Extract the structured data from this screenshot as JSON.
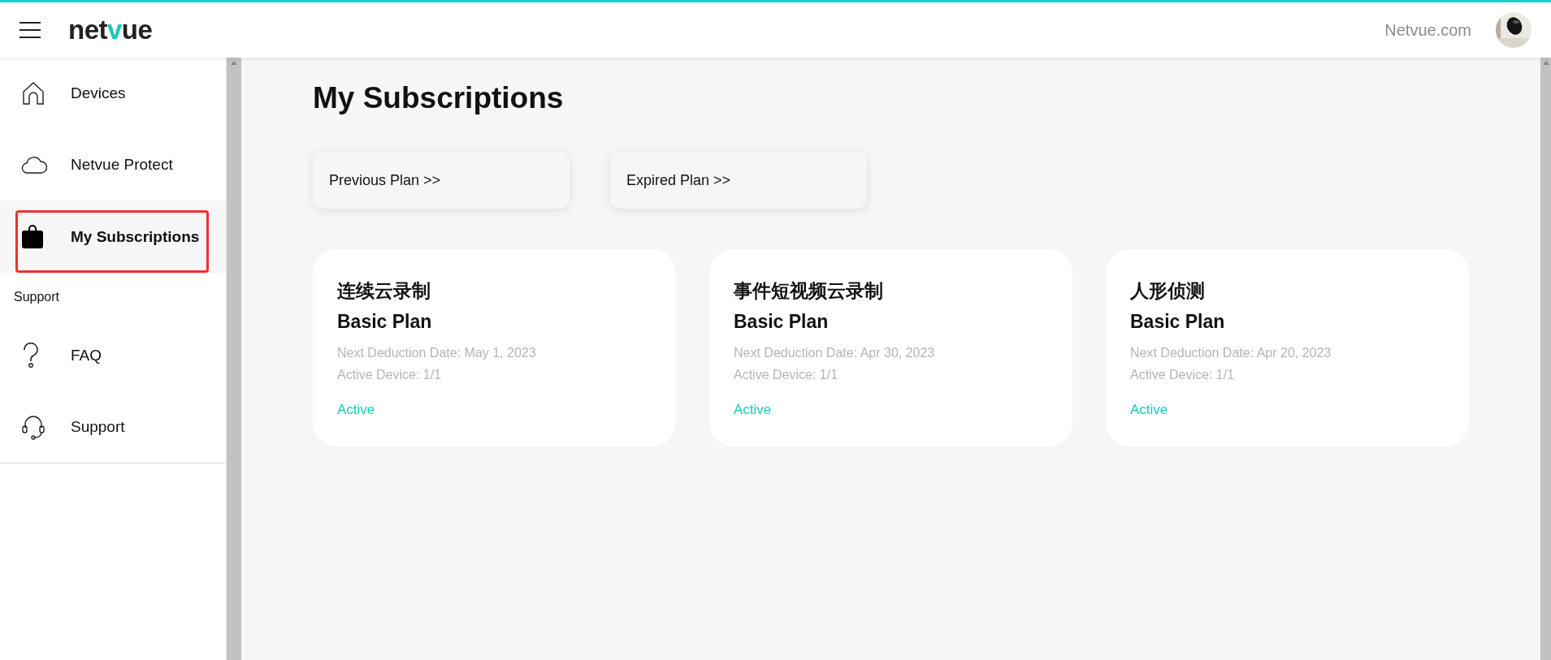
{
  "header": {
    "logo": [
      "net",
      "v",
      "ue"
    ],
    "site_link": "Netvue.com"
  },
  "sidebar": {
    "items": [
      {
        "label": "Devices",
        "selected": false,
        "highlighted": false
      },
      {
        "label": "Netvue Protect",
        "selected": false,
        "highlighted": false
      },
      {
        "label": "My Subscriptions",
        "selected": true,
        "highlighted": true
      }
    ],
    "section_title": "Support",
    "support_items": [
      {
        "label": "FAQ",
        "selected": false
      },
      {
        "label": "Support",
        "selected": false
      }
    ]
  },
  "page_title": "My Subscriptions",
  "plan_links": [
    "Previous Plan >>",
    "Expired Plan >>"
  ],
  "subscriptions": [
    {
      "service": "连续云录制",
      "plan": "Basic Plan",
      "next_deduction": "Next Deduction Date: May 1, 2023",
      "devices": "Active Device: 1/1",
      "status": "Active"
    },
    {
      "service": "事件短视频云录制",
      "plan": "Basic Plan",
      "next_deduction": "Next Deduction Date: Apr 30, 2023",
      "devices": "Active Device: 1/1",
      "status": "Active"
    },
    {
      "service": "人形侦测",
      "plan": "Basic Plan",
      "next_deduction": "Next Deduction Date: Apr 20, 2023",
      "devices": "Active Device: 1/1",
      "status": "Active"
    }
  ]
}
